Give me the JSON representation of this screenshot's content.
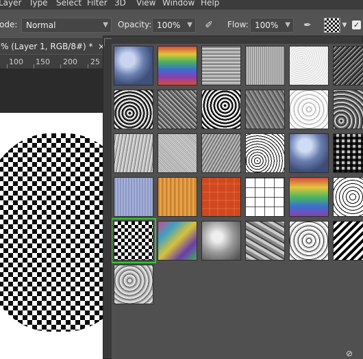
{
  "menubar": {
    "items": [
      "Layer",
      "Type",
      "Select",
      "Filter",
      "3D",
      "View",
      "Window",
      "Help"
    ]
  },
  "options": {
    "mode_label": "ode:",
    "mode_value": "Normal",
    "opacity_label": "Opacity:",
    "opacity_value": "100%",
    "flow_label": "Flow:",
    "flow_value": "100%"
  },
  "document": {
    "tab_title": "% (Layer 1, RGB/8#) *",
    "close_glyph": "×",
    "ruler_ticks": [
      "100",
      "150",
      "200",
      "25"
    ]
  },
  "pattern_panel": {
    "patterns": [
      "bubbles",
      "rainbow-swirl",
      "fibers-1",
      "fibers-2",
      "paper-white",
      "noise-dark",
      "rock-1",
      "rock-2",
      "rock-3",
      "rock-4",
      "spatter-white",
      "gravel",
      "concrete",
      "fine-noise",
      "scratches",
      "cracked",
      "bubbles-2",
      "weave",
      "blue-fabric",
      "wood",
      "orange-tiles",
      "white-grid",
      "rainbow-swirl-2",
      "black-lines",
      "checker-warp",
      "psychedelic",
      "clouds",
      "crystals",
      "veins",
      "chevron",
      "marble-gray"
    ],
    "selected_index": 24
  },
  "colors": {
    "selection": "#39c439",
    "panel_bg": "#505050"
  }
}
